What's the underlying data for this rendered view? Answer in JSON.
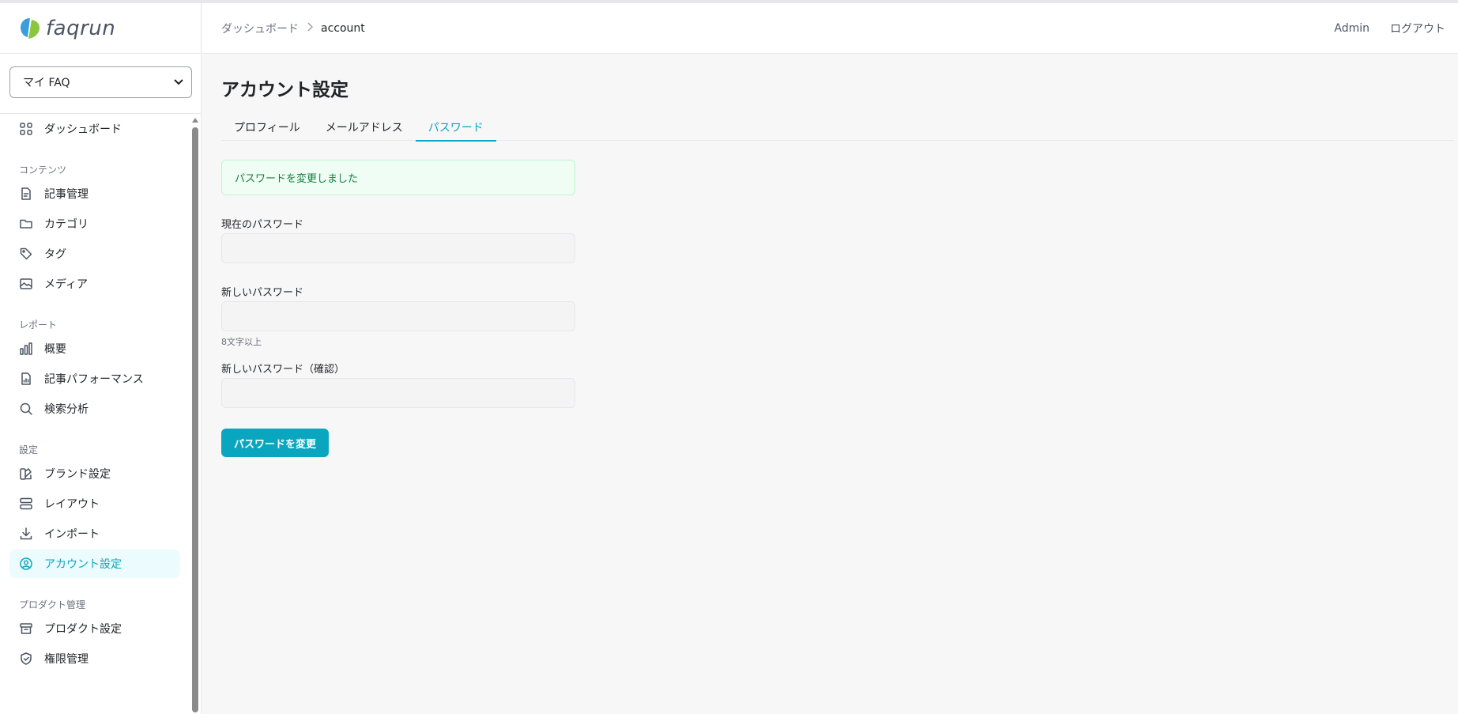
{
  "app": {
    "logo_text": "faqrun",
    "brand_color": "#0aa6c0",
    "logo_colors": [
      "#3a9fd8",
      "#8cc63f"
    ]
  },
  "sidebar": {
    "faq_select": {
      "value": "マイ FAQ",
      "icon": "chevron-down-icon"
    },
    "items": [
      {
        "key": "dashboard",
        "label": "ダッシュボード",
        "icon": "grid-icon"
      },
      {
        "section": "コンテンツ"
      },
      {
        "key": "articles",
        "label": "記事管理",
        "icon": "document-icon"
      },
      {
        "key": "categories",
        "label": "カテゴリ",
        "icon": "folder-icon"
      },
      {
        "key": "tags",
        "label": "タグ",
        "icon": "tag-icon"
      },
      {
        "key": "media",
        "label": "メディア",
        "icon": "image-icon"
      },
      {
        "section": "レポート"
      },
      {
        "key": "overview",
        "label": "概要",
        "icon": "bar-chart-icon"
      },
      {
        "key": "article-performance",
        "label": "記事パフォーマンス",
        "icon": "document-chart-icon"
      },
      {
        "key": "search-analysis",
        "label": "検索分析",
        "icon": "search-icon"
      },
      {
        "section": "設定"
      },
      {
        "key": "brand-settings",
        "label": "ブランド設定",
        "icon": "palette-icon"
      },
      {
        "key": "layout",
        "label": "レイアウト",
        "icon": "layout-icon"
      },
      {
        "key": "import",
        "label": "インポート",
        "icon": "download-icon"
      },
      {
        "key": "account-settings",
        "label": "アカウント設定",
        "icon": "user-circle-icon",
        "active": true
      },
      {
        "section": "プロダクト管理"
      },
      {
        "key": "product-settings",
        "label": "プロダクト設定",
        "icon": "archive-icon"
      },
      {
        "key": "permissions",
        "label": "権限管理",
        "icon": "shield-icon"
      }
    ]
  },
  "header": {
    "breadcrumb": {
      "parent": "ダッシュボード",
      "current": "account"
    },
    "user": "Admin",
    "logout": "ログアウト"
  },
  "main": {
    "title": "アカウント設定",
    "tabs": [
      {
        "label": "プロフィール",
        "active": false
      },
      {
        "label": "メールアドレス",
        "active": false
      },
      {
        "label": "パスワード",
        "active": true
      }
    ],
    "alert": "パスワードを変更しました",
    "form": {
      "current_password": {
        "label": "現在のパスワード",
        "value": ""
      },
      "new_password": {
        "label": "新しいパスワード",
        "value": "",
        "hint": "8文字以上"
      },
      "confirm_password": {
        "label": "新しいパスワード（確認）",
        "value": ""
      },
      "submit_label": "パスワードを変更"
    }
  }
}
